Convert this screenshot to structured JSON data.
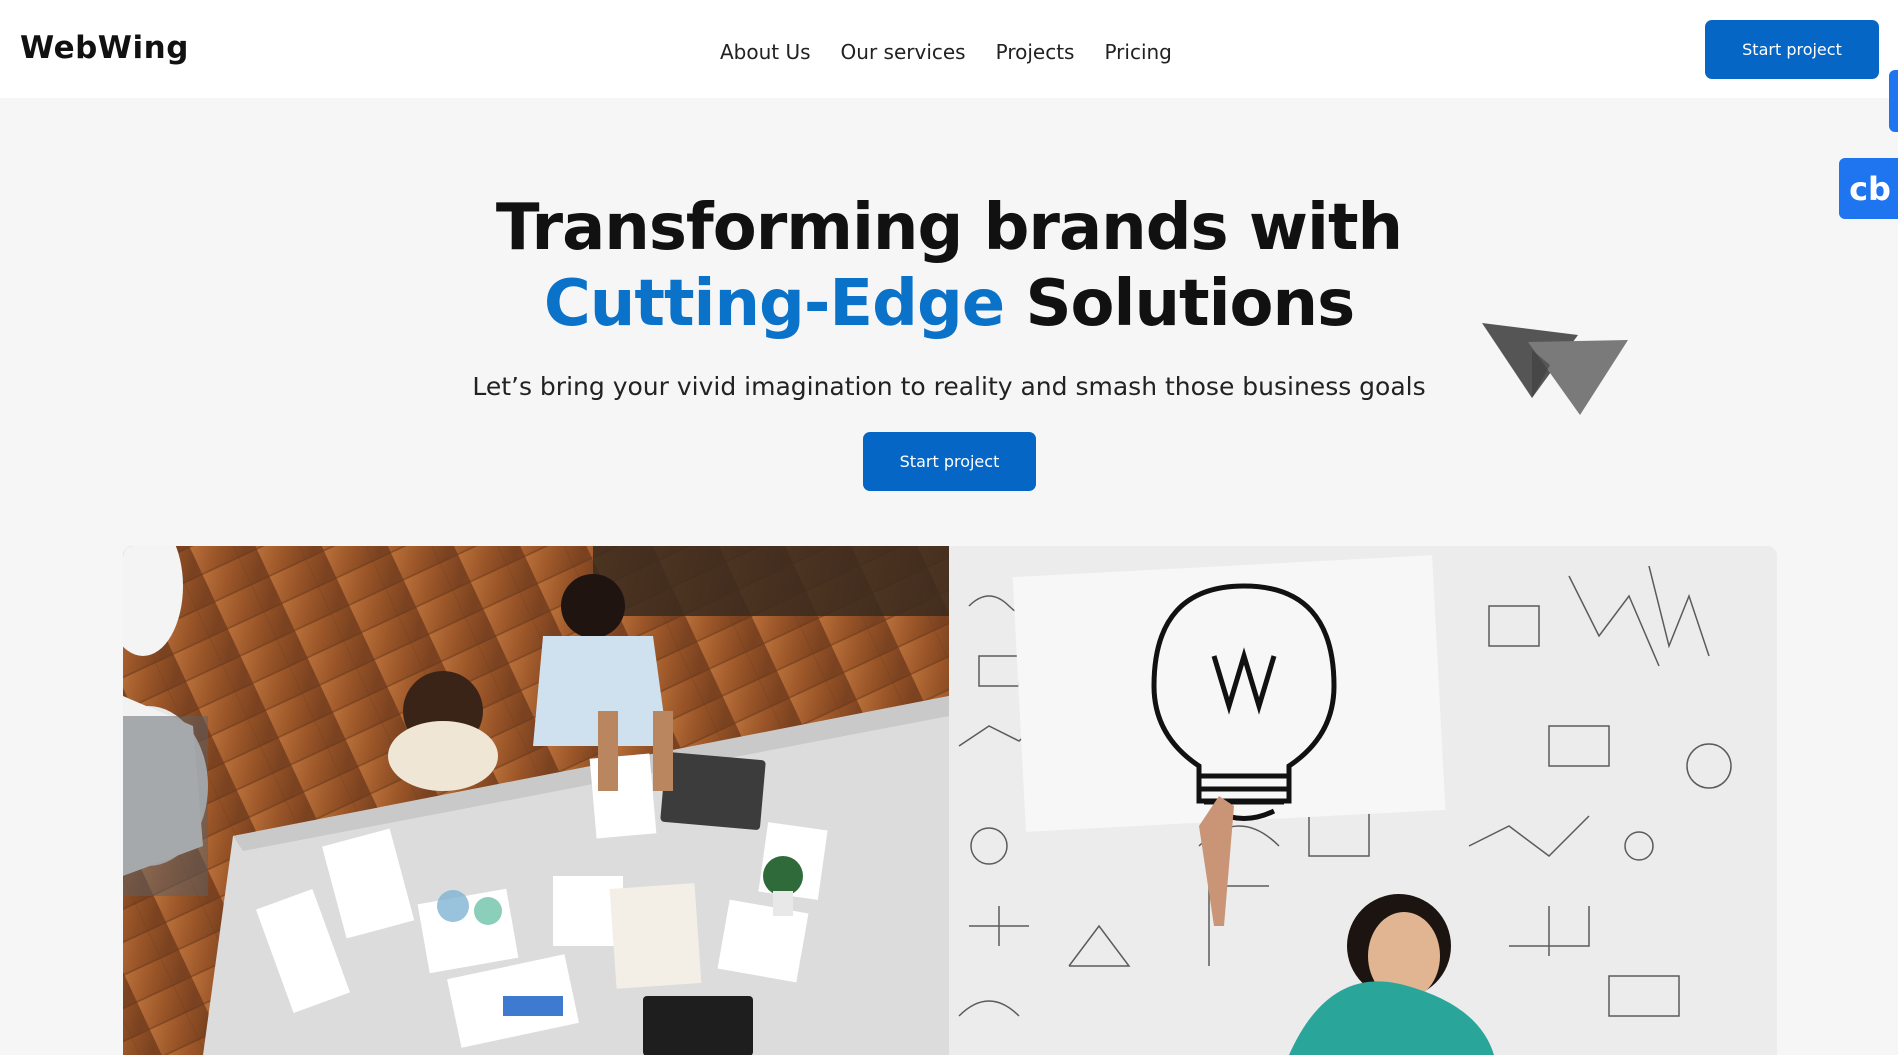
{
  "header": {
    "logo": "WebWing",
    "nav": [
      "About Us",
      "Our services",
      "Projects",
      "Pricing"
    ],
    "cta_label": "Start project"
  },
  "side_widget": {
    "label": "cb",
    "color": "#1f74f0"
  },
  "hero": {
    "title_line1": "Transforming brands with",
    "title_accent": "Cutting-Edge",
    "title_rest": " Solutions",
    "subtitle": "Let’s bring your vivid imagination to reality and smash those business goals",
    "cta_label": "Start project"
  },
  "colors": {
    "accent": "#0a72c8",
    "button": "#0566c5",
    "page_bg": "#f6f6f6"
  },
  "images": {
    "left": "team-meeting-overhead-photo",
    "right": "woman-holding-lightbulb-drawing-photo"
  }
}
